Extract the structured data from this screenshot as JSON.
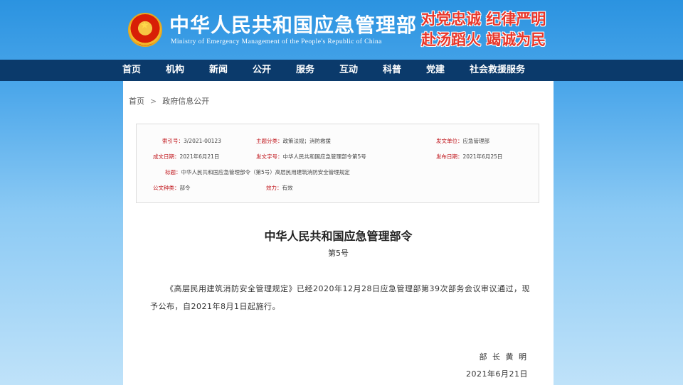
{
  "header": {
    "title": "中华人民共和国应急管理部",
    "subtitle": "Ministry of Emergency Management of the People's Republic of China",
    "slogans": [
      "对党忠诚 纪律严明",
      "赴汤蹈火 竭诚为民"
    ]
  },
  "nav": {
    "items": [
      "首页",
      "机构",
      "新闻",
      "公开",
      "服务",
      "互动",
      "科普",
      "党建",
      "社会救援服务"
    ]
  },
  "breadcrumb": {
    "home": "首页",
    "separator": ">",
    "current": "政府信息公开"
  },
  "info": {
    "index_label": "索引号：",
    "index_value": "3/2021-00123",
    "topic_label": "主题分类：",
    "topic_value": "政策法规；消防救援",
    "issuer_label": "发文单位：",
    "issuer_value": "应急管理部",
    "created_label": "成文日期：",
    "created_value": "2021年6月21日",
    "docno_label": "发文字号：",
    "docno_value": "中华人民共和国应急管理部令第5号",
    "published_label": "发布日期：",
    "published_value": "2021年6月25日",
    "title_label": "标题：",
    "title_value": "中华人民共和国应急管理部令（第5号）高层民用建筑消防安全管理规定",
    "type_label": "公文种类：",
    "type_value": "部令",
    "validity_label": "效力：",
    "validity_value": "有效"
  },
  "document": {
    "title": "中华人民共和国应急管理部令",
    "number": "第5号",
    "body": "《高层民用建筑消防安全管理规定》已经2020年12月28日应急管理部第39次部务会议审议通过，现予公布，自2021年8月1日起施行。",
    "signer": "部 长  黄 明",
    "date": "2021年6月21日"
  }
}
